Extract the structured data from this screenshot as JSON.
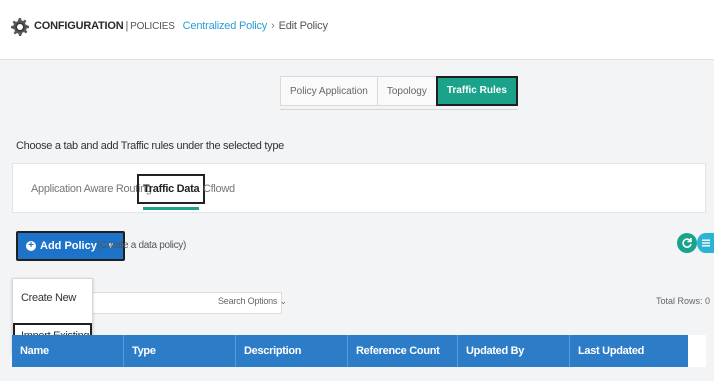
{
  "header": {
    "section": "CONFIGURATION",
    "separator": "|",
    "subsection": "POLICIES",
    "link": "Centralized Policy",
    "arrow": "›",
    "current": "Edit Policy"
  },
  "top_tabs": [
    {
      "label": "Policy Application",
      "active": false
    },
    {
      "label": "Topology",
      "active": false
    },
    {
      "label": "Traffic Rules",
      "active": true
    }
  ],
  "instruction": "Choose a tab and add Traffic rules under the selected type",
  "type_tabs": [
    {
      "label": "Application Aware Routing",
      "active": false
    },
    {
      "label": "Traffic Data",
      "active": true
    },
    {
      "label": "Cflowd",
      "active": false
    }
  ],
  "toolbar": {
    "add_policy_label": "Add Policy",
    "add_policy_hint": "(Create a data policy)"
  },
  "dropdown": {
    "items": [
      "Create New",
      "Import Existing"
    ]
  },
  "search": {
    "placeholder": "",
    "options_label": "Search Options ⌄"
  },
  "total_rows": "Total Rows: 0",
  "table": {
    "columns": [
      "Name",
      "Type",
      "Description",
      "Reference Count",
      "Updated By",
      "Last Updated"
    ]
  },
  "colors": {
    "accent_green": "#1aa38a",
    "primary_blue": "#1d73c9",
    "table_header": "#2d7cc8"
  },
  "icons": {
    "header": "gear-icon",
    "add": "plus-circle-icon",
    "refresh": "refresh-icon",
    "menu": "list-icon"
  }
}
